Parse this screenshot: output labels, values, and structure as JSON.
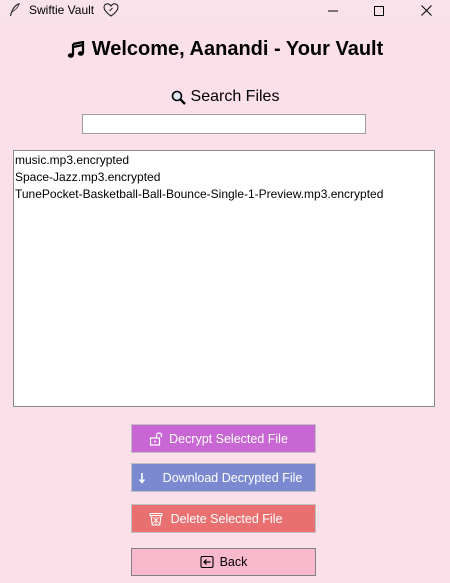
{
  "window": {
    "title": "Swiftie Vault",
    "app_icon": "quill-icon",
    "title_icon": "heart-outline-icon"
  },
  "header": {
    "icon": "music-note-icon",
    "title": "Welcome, Aanandi - Your Vault"
  },
  "search": {
    "icon": "magnifier-icon",
    "label": "Search Files",
    "value": "",
    "placeholder": ""
  },
  "files": [
    "music.mp3.encrypted",
    "Space-Jazz.mp3.encrypted",
    "TunePocket-Basketball-Ball-Bounce-Single-1-Preview.mp3.encrypted"
  ],
  "actions": {
    "decrypt_label": "Decrypt Selected File",
    "download_label": "Download Decrypted File",
    "delete_label": "Delete Selected File",
    "back_label": "Back"
  },
  "colors": {
    "background": "#fbe0e9",
    "decrypt": "#c867d3",
    "download": "#7b8ad0",
    "delete": "#e87070",
    "back": "#f8b9cd"
  }
}
